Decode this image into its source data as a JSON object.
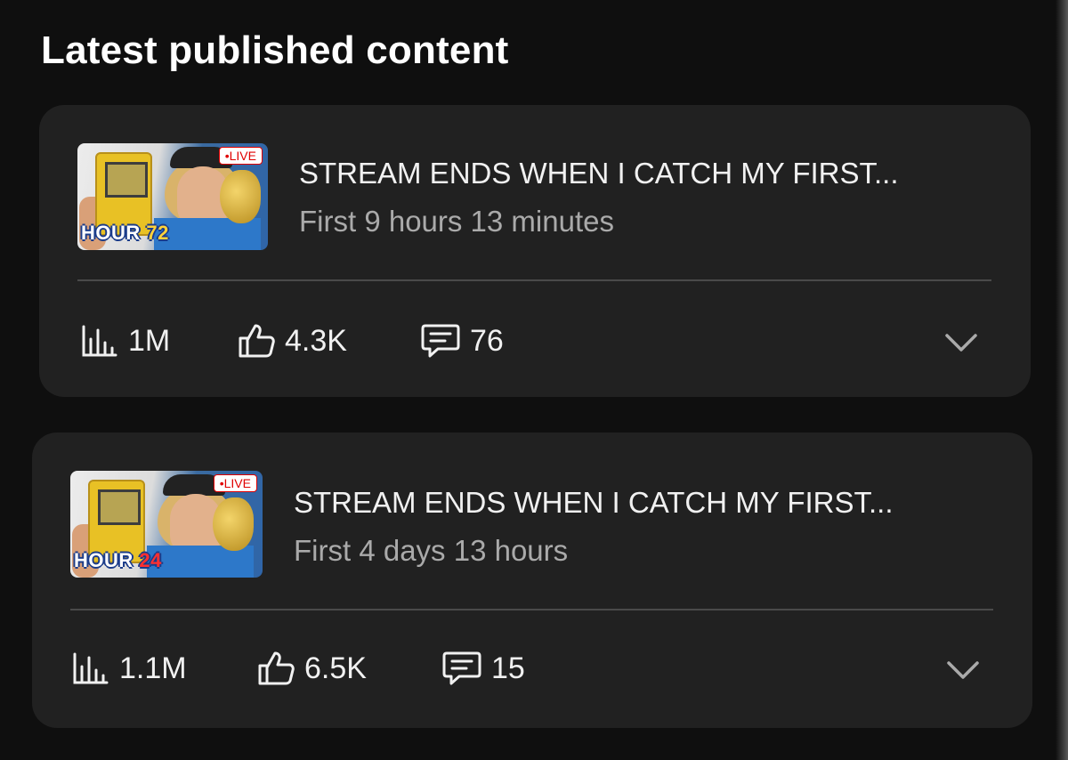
{
  "section": {
    "title": "Latest published content"
  },
  "videos": [
    {
      "live_badge": "•LIVE",
      "thumb_hour_label": "HOUR ",
      "thumb_hour_number": "72",
      "title": "STREAM ENDS WHEN I CATCH MY FIRST...",
      "subtitle": "First 9 hours 13 minutes",
      "views": "1M",
      "likes": "4.3K",
      "comments": "76"
    },
    {
      "live_badge": "•LIVE",
      "thumb_hour_label": "HOUR ",
      "thumb_hour_number": "24",
      "title": "STREAM ENDS WHEN I CATCH MY FIRST...",
      "subtitle": "First 4 days 13 hours",
      "views": "1.1M",
      "likes": "6.5K",
      "comments": "15"
    }
  ],
  "icons": {
    "views": "bar-chart-icon",
    "likes": "thumbs-up-icon",
    "comments": "comment-icon",
    "expand": "chevron-down-icon"
  },
  "colors": {
    "background": "#0f0f0f",
    "card": "#212121",
    "text_primary": "#f1f1f1",
    "text_secondary": "#aaaaaa",
    "live_red": "#e00000"
  }
}
